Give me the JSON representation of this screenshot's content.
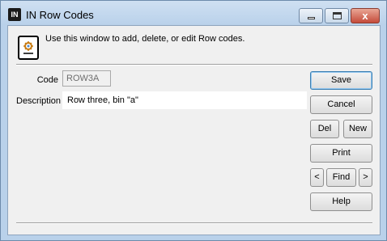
{
  "window": {
    "title": "IN Row Codes",
    "app_icon_text": "IN",
    "icon": "document-gear-icon"
  },
  "header": {
    "info_text": "Use this window to add, delete, or edit Row codes."
  },
  "form": {
    "code_label": "Code",
    "code_value": "ROW3A",
    "description_label": "Description",
    "description_value": "Row three, bin \"a\""
  },
  "buttons": {
    "save": "Save",
    "cancel": "Cancel",
    "del": "Del",
    "new": "New",
    "print": "Print",
    "prev": "<",
    "find": "Find",
    "next": ">",
    "help": "Help"
  },
  "titlebar_controls": {
    "close_glyph": "x"
  }
}
